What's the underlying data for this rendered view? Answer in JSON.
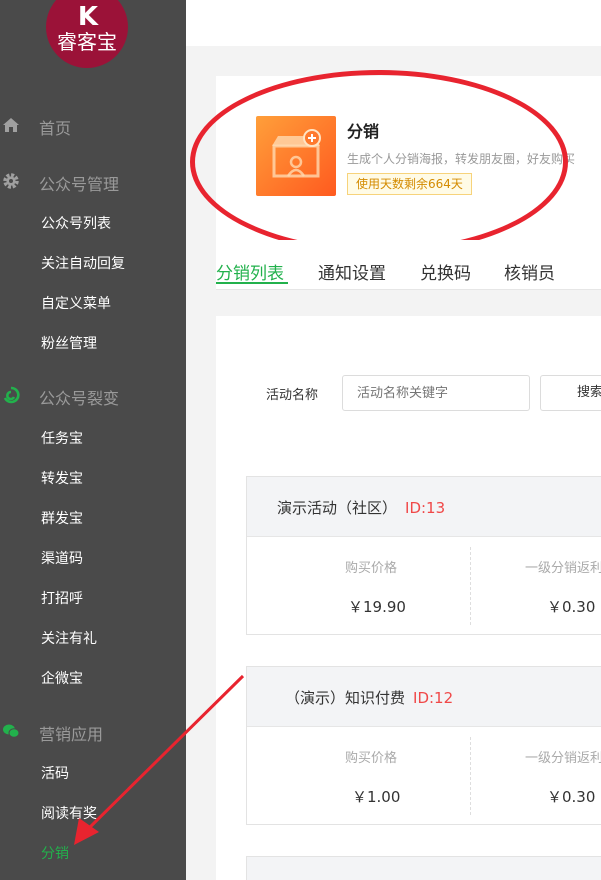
{
  "sidebar": {
    "logo_text": "睿客宝",
    "logo_mark": "K",
    "groups": [
      {
        "label": "首页",
        "icon": "home-icon"
      },
      {
        "label": "公众号管理",
        "icon": "gear-icon",
        "items": [
          "公众号列表",
          "关注自动回复",
          "自定义菜单",
          "粉丝管理"
        ]
      },
      {
        "label": "公众号裂变",
        "icon": "fission-icon",
        "items": [
          "任务宝",
          "转发宝",
          "群发宝",
          "渠道码",
          "打招呼",
          "关注有礼",
          "企微宝"
        ]
      },
      {
        "label": "营销应用",
        "icon": "wechat-icon",
        "items": [
          "活码",
          "阅读有奖",
          "分销"
        ]
      }
    ],
    "active_item": "分销"
  },
  "app": {
    "title": "分销",
    "description": "生成个人分销海报，转发朋友圈，好友购买",
    "badge": "使用天数剩余664天",
    "icon": "store-icon"
  },
  "tabs": [
    "分销列表",
    "通知设置",
    "兑换码",
    "核销员"
  ],
  "active_tab": "分销列表",
  "search": {
    "label": "活动名称",
    "placeholder": "活动名称关键字",
    "button": "搜索"
  },
  "activities": [
    {
      "title": "演示活动（社区）",
      "id": "ID:13",
      "price_label": "购买价格",
      "price": "￥19.90",
      "rebate_label": "一级分销返利",
      "rebate": "￥0.30"
    },
    {
      "title": "（演示）知识付费",
      "id": "ID:12",
      "price_label": "购买价格",
      "price": "￥1.00",
      "rebate_label": "一级分销返利",
      "rebate": "￥0.30"
    }
  ],
  "colors": {
    "sidebar_bg": "#4a4a4a",
    "accent_green": "#22b14c",
    "annotation_red": "#e8242f",
    "id_red": "#f04848",
    "logo_bg": "#9b1238"
  }
}
